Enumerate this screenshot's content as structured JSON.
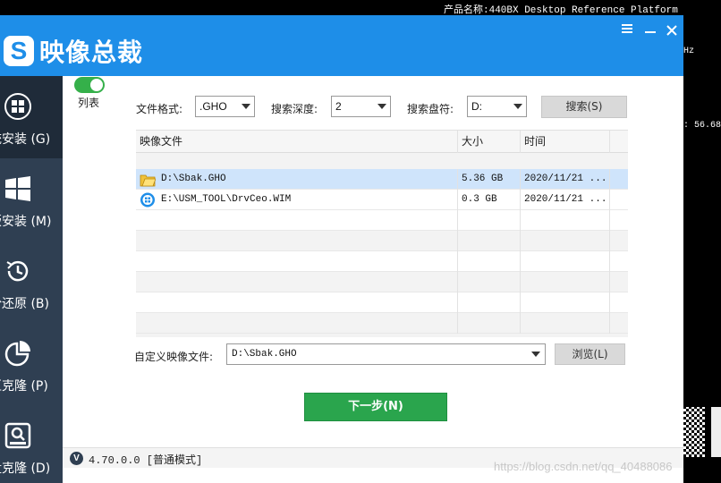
{
  "desktop": {
    "top_text": "产品名称:440BX Desktop Reference Platform",
    "side_text_1": "Hz",
    "side_text_2": ": 56.68"
  },
  "window": {
    "app_title": "映像总裁",
    "logo_letter": "S"
  },
  "sidebar": {
    "items": [
      {
        "label": "统安装 (G)",
        "icon": "windows-logo-circle-icon"
      },
      {
        "label": "版安装 (M)",
        "icon": "windows-tiles-icon"
      },
      {
        "label": "份还原 (B)",
        "icon": "restore-clock-icon"
      },
      {
        "label": "区克隆 (P)",
        "icon": "partition-pie-icon"
      },
      {
        "label": "盘克隆 (D)",
        "icon": "disk-search-icon"
      }
    ]
  },
  "toggle": {
    "label": "列表",
    "state": "on"
  },
  "filters": {
    "format_label": "文件格式:",
    "format_value": ".GHO",
    "depth_label": "搜索深度:",
    "depth_value": "2",
    "drive_label": "搜索盘符:",
    "drive_value": "D:",
    "search_button": "搜索(S)"
  },
  "table": {
    "headers": [
      "映像文件",
      "大小",
      "时间"
    ],
    "rows": [
      {
        "file": "D:\\Sbak.GHO",
        "size": "5.36 GB",
        "time": "2020/11/21 ...",
        "icon": "ghost-file-icon",
        "selected": true
      },
      {
        "file": "E:\\USM_TOOL\\DrvCeo.WIM",
        "size": "0.3 GB",
        "time": "2020/11/21 ...",
        "icon": "wim-file-icon",
        "selected": false
      }
    ]
  },
  "custom": {
    "label": "自定义映像文件:",
    "value": "D:\\Sbak.GHO",
    "browse_button": "浏览(L)"
  },
  "next_button": "下一步(N)",
  "status": {
    "version_badge": "V",
    "version_text": "4.70.0.0 [普通模式]"
  },
  "watermark": "https://blog.csdn.net/qq_40488086",
  "colors": {
    "title_bar": "#1e8ee8",
    "sidebar": "#2f3f52",
    "next_button": "#2aa54d",
    "selected_row": "#cfe4fb"
  }
}
